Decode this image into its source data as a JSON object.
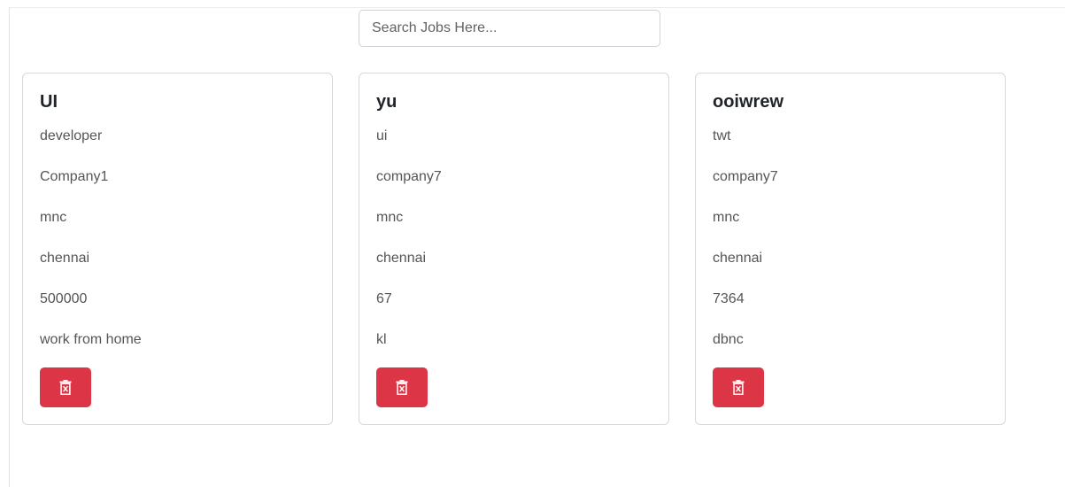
{
  "search": {
    "placeholder": "Search Jobs Here...",
    "value": ""
  },
  "colors": {
    "delete_button": "#dc3545"
  },
  "jobs": [
    {
      "title": "UI",
      "role": "developer",
      "company": "Company1",
      "type": "mnc",
      "location": "chennai",
      "salary": "500000",
      "mode": "work from home",
      "delete_icon": "trash-x-icon"
    },
    {
      "title": "yu",
      "role": "ui",
      "company": "company7",
      "type": "mnc",
      "location": "chennai",
      "salary": "67",
      "mode": "kl",
      "delete_icon": "trash-x-icon"
    },
    {
      "title": "ooiwrew",
      "role": "twt",
      "company": "company7",
      "type": "mnc",
      "location": "chennai",
      "salary": "7364",
      "mode": "dbnc",
      "delete_icon": "trash-x-icon"
    }
  ]
}
